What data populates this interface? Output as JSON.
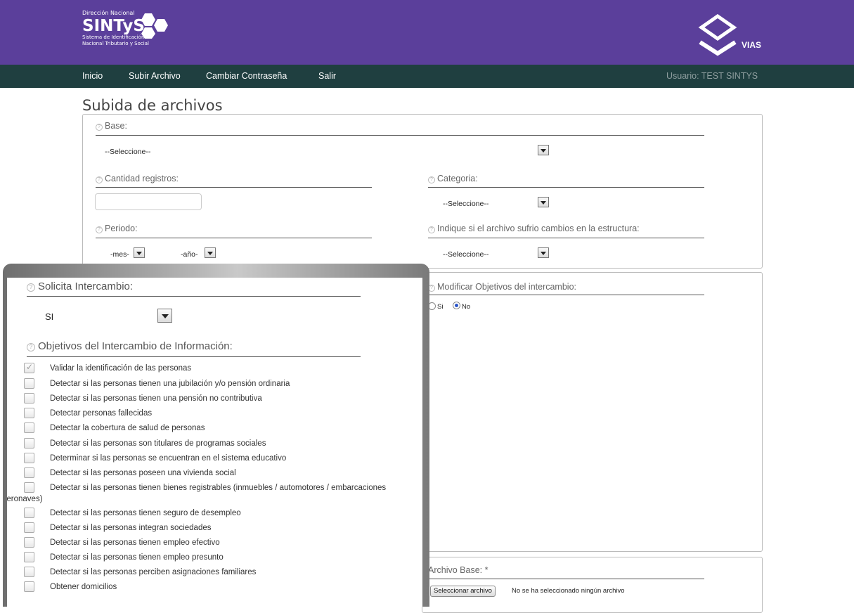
{
  "header": {
    "org_top": "Dirección Nacional",
    "org_name": "SINTyS",
    "org_sub1": "Sistema de Identificación",
    "org_sub2": "Nacional Tributario y Social",
    "vias_label": "VIAS",
    "brand_color": "#5b3f9b",
    "nav_color": "#1f3f40"
  },
  "nav": {
    "items": [
      "Inicio",
      "Subir Archivo",
      "Cambiar Contraseña",
      "Salir"
    ],
    "user": "Usuario: TEST SINTYS"
  },
  "page": {
    "title": "Subida de archivos"
  },
  "form": {
    "base_label": "Base:",
    "base_value": "--Seleccione--",
    "cantidad_label": "Cantidad registros:",
    "cantidad_value": "",
    "categoria_label": "Categoria:",
    "categoria_value": "--Seleccione--",
    "periodo_label": "Periodo:",
    "mes_value": "-mes-",
    "anio_value": "-año-",
    "cambios_label": "Indique si el archivo sufrio cambios en la estructura:",
    "cambios_value": "--Seleccione--",
    "modificar_label": "Modificar Objetivos del intercambio:",
    "radio_si": "Si",
    "radio_no": "No",
    "radio_selected": "No",
    "archivo_label": "Archivo Base: *",
    "file_button": "Seleccionar archivo",
    "file_status": "No se ha seleccionado ningún archivo"
  },
  "zoom": {
    "solicita_label": "Solicita Intercambio:",
    "solicita_value": "SI",
    "objetivos_label": "Objetivos del Intercambio de Información:",
    "objectives": [
      {
        "text": "Validar la identificación de las personas",
        "checked": true
      },
      {
        "text": "Detectar si las personas tienen una jubilación y/o pensión ordinaria",
        "checked": false
      },
      {
        "text": "Detectar si las personas tienen una pensión no contributiva",
        "checked": false
      },
      {
        "text": "Detectar personas fallecidas",
        "checked": false
      },
      {
        "text": "Detectar la cobertura de salud de personas",
        "checked": false
      },
      {
        "text": "Detectar si las personas son titulares de programas sociales",
        "checked": false
      },
      {
        "text": "Determinar si las personas se encuentran en el sistema educativo",
        "checked": false
      },
      {
        "text": "Detectar si las personas poseen una vivienda social",
        "checked": false
      },
      {
        "text": "Detectar si las personas tienen bienes registrables (inmuebles / automotores / embarcaciones",
        "cont": "aeronaves)",
        "checked": false
      },
      {
        "text": "Detectar si las personas tienen seguro de desempleo",
        "checked": false
      },
      {
        "text": "Detectar si las personas integran sociedades",
        "checked": false
      },
      {
        "text": "Detectar si las personas tienen empleo efectivo",
        "checked": false
      },
      {
        "text": "Detectar si las personas tienen empleo presunto",
        "checked": false
      },
      {
        "text": "Detectar si las personas perciben asignaciones familiares",
        "checked": false
      },
      {
        "text": "Obtener domicilios",
        "checked": false
      }
    ]
  }
}
